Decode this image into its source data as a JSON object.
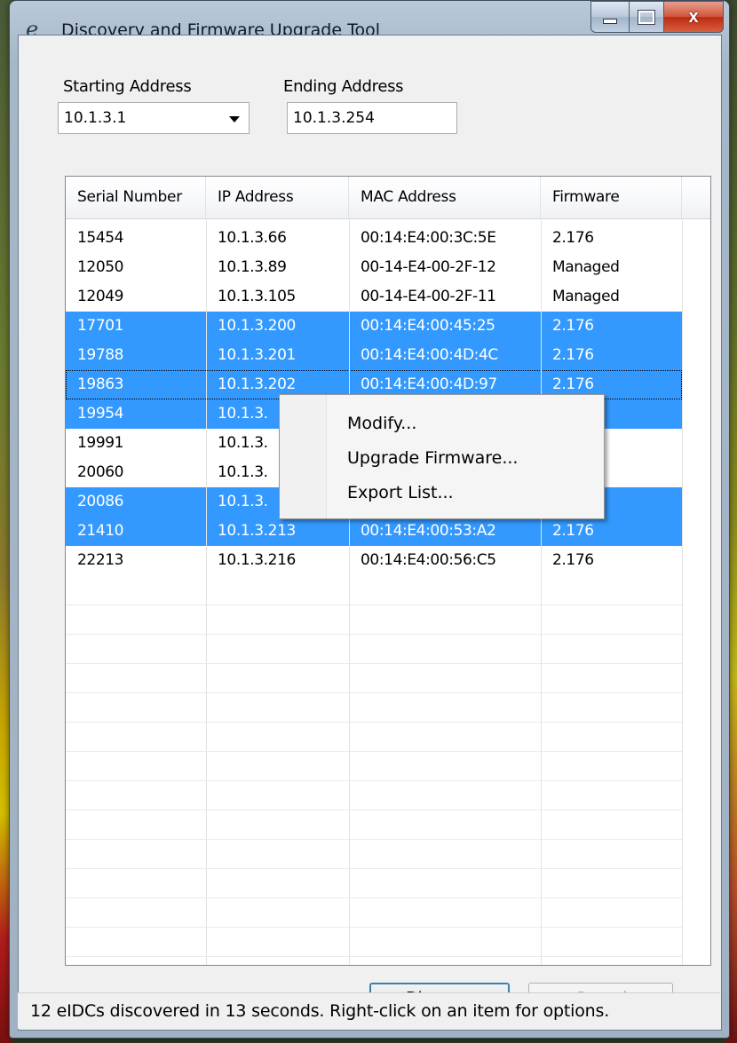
{
  "window": {
    "title": "Discovery and Firmware Upgrade Tool",
    "app_icon": "e-icon",
    "caption_buttons": [
      "minimize",
      "maximize",
      "close"
    ],
    "close_glyph": "x"
  },
  "form": {
    "starting_address_label": "Starting Address",
    "starting_address_value": "10.1.3.1",
    "ending_address_label": "Ending Address",
    "ending_address_value": "10.1.3.254"
  },
  "table": {
    "columns": [
      "Serial Number",
      "IP Address",
      "MAC Address",
      "Firmware"
    ],
    "rows": [
      {
        "serial": "15454",
        "ip": "10.1.3.66",
        "mac": "00:14:E4:00:3C:5E",
        "firmware": "2.176",
        "selected": false
      },
      {
        "serial": "12050",
        "ip": "10.1.3.89",
        "mac": "00-14-E4-00-2F-12",
        "firmware": "Managed",
        "selected": false
      },
      {
        "serial": "12049",
        "ip": "10.1.3.105",
        "mac": "00-14-E4-00-2F-11",
        "firmware": "Managed",
        "selected": false
      },
      {
        "serial": "17701",
        "ip": "10.1.3.200",
        "mac": "00:14:E4:00:45:25",
        "firmware": "2.176",
        "selected": true
      },
      {
        "serial": "19788",
        "ip": "10.1.3.201",
        "mac": "00:14:E4:00:4D:4C",
        "firmware": "2.176",
        "selected": true
      },
      {
        "serial": "19863",
        "ip": "10.1.3.202",
        "mac": "00:14:E4:00:4D:97",
        "firmware": "2.176",
        "selected": true,
        "focused": true
      },
      {
        "serial": "19954",
        "ip": "10.1.3.",
        "mac": "",
        "firmware": "",
        "selected": true
      },
      {
        "serial": "19991",
        "ip": "10.1.3.",
        "mac": "",
        "firmware": "",
        "selected": false
      },
      {
        "serial": "20060",
        "ip": "10.1.3.",
        "mac": "",
        "firmware": "",
        "selected": false
      },
      {
        "serial": "20086",
        "ip": "10.1.3.",
        "mac": "",
        "firmware": "",
        "selected": true
      },
      {
        "serial": "21410",
        "ip": "10.1.3.213",
        "mac": "00:14:E4:00:53:A2",
        "firmware": "2.176",
        "selected": true
      },
      {
        "serial": "22213",
        "ip": "10.1.3.216",
        "mac": "00:14:E4:00:56:C5",
        "firmware": "2.176",
        "selected": false
      }
    ]
  },
  "context_menu": {
    "items": [
      "Modify...",
      "Upgrade Firmware...",
      "Export List..."
    ]
  },
  "buttons": {
    "discover": "Discover",
    "cancel": "Cancel"
  },
  "status": {
    "text": "12 eIDCs discovered in 13 seconds.  Right-click on an item for options."
  },
  "colors": {
    "selection": "#3399ff",
    "window_frame": "#a5b7c8",
    "close_button": "#c8452c"
  }
}
